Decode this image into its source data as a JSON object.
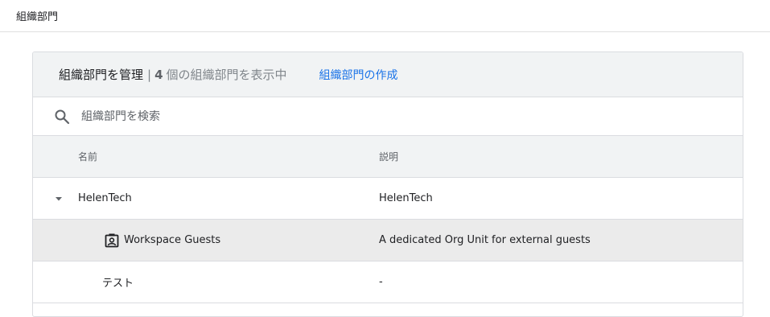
{
  "topbar": {
    "title": "組織部門"
  },
  "card": {
    "title": "組織部門を管理",
    "separator": "|",
    "count": "4",
    "count_text": "個の組織部門を表示中",
    "create_link": "組織部門の作成"
  },
  "search": {
    "placeholder": "組織部門を検索",
    "value": ""
  },
  "table": {
    "columns": {
      "name": "名前",
      "description": "説明"
    },
    "rows": [
      {
        "name": "HelenTech",
        "description": "HelenTech",
        "expanded": true
      },
      {
        "name": "Workspace Guests",
        "description": "A dedicated Org Unit for external guests",
        "icon": "guest-org-icon"
      },
      {
        "name": "テスト",
        "description": "-"
      }
    ]
  },
  "colors": {
    "accent": "#1a73e8",
    "header_bg": "#f1f3f4",
    "selected_row_bg": "#ebebeb"
  }
}
